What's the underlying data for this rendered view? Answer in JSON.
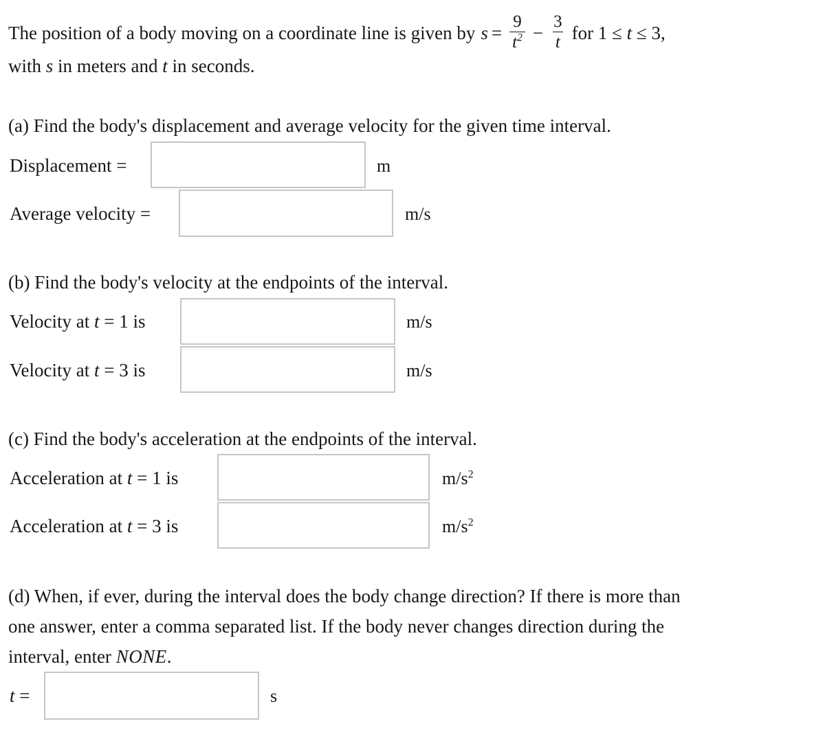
{
  "problem": {
    "intro_before_formula": "The position of a body moving on a coordinate line is given by",
    "formula": {
      "lhs": "s",
      "equals": "=",
      "term1_numerator": "9",
      "term1_denominator": "t",
      "term1_denominator_exponent": "2",
      "operator": "−",
      "term2_numerator": "3",
      "term2_denominator": "t",
      "domain_text": "for 1 ≤ t ≤ 3,"
    },
    "units_line": "with s in meters and t in seconds."
  },
  "parts": {
    "a": {
      "prompt": "(a) Find the body's displacement and average velocity for the given time interval.",
      "rows": [
        {
          "label": "Displacement =",
          "value": "",
          "placeholder": "",
          "unit": "m"
        },
        {
          "label": "Average velocity =",
          "value": "",
          "placeholder": "",
          "unit": "m/s"
        }
      ]
    },
    "b": {
      "prompt": "(b) Find the body's velocity at the endpoints of the interval.",
      "rows": [
        {
          "label_pre": "Velocity at ",
          "label_var": "t",
          "label_eq": "=",
          "label_val": "1",
          "label_post": " is",
          "value": "",
          "placeholder": "",
          "unit": "m/s"
        },
        {
          "label_pre": "Velocity at ",
          "label_var": "t",
          "label_eq": "=",
          "label_val": "3",
          "label_post": " is",
          "value": "",
          "placeholder": "",
          "unit": "m/s"
        }
      ]
    },
    "c": {
      "prompt": "(c) Find the body's acceleration at the endpoints of the interval.",
      "rows": [
        {
          "label_pre": "Acceleration at ",
          "label_var": "t",
          "label_eq": "=",
          "label_val": "1",
          "label_post": " is",
          "value": "",
          "placeholder": "",
          "unit_base": "m/s",
          "unit_exp": "2"
        },
        {
          "label_pre": "Acceleration at ",
          "label_var": "t",
          "label_eq": "=",
          "label_val": "3",
          "label_post": " is",
          "value": "",
          "placeholder": "",
          "unit_base": "m/s",
          "unit_exp": "2"
        }
      ]
    },
    "d": {
      "prompt_line1": "(d) When, if ever, during the interval does the body change direction? If there is more than",
      "prompt_line2": "one answer, enter a comma separated list. If the body never changes direction during the",
      "prompt_line3_pre": "interval, enter ",
      "prompt_line3_em": "NONE",
      "prompt_line3_post": ".",
      "row": {
        "label_var": "t",
        "label_eq": "=",
        "value": "",
        "placeholder": "",
        "unit": "s"
      }
    }
  },
  "colors": {
    "text": "#17171a",
    "box_border": "#c6c6c6",
    "background": "#ffffff"
  }
}
